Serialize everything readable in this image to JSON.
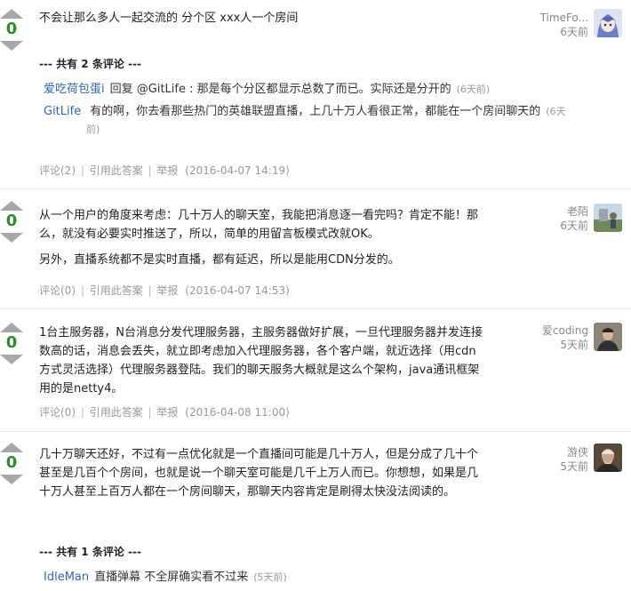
{
  "answers": [
    {
      "votes": "0",
      "body": [
        "不会让那么多人一起交流的 分个区 xxx人一个房间"
      ],
      "author": "TimeFo...",
      "time": "6天前",
      "comments_header": "--- 共有 2 条评论 ---",
      "comments": [
        {
          "user": "爱吃荷包蛋i",
          "text": "回复 @GitLife : 那是每个分区都显示总数了而已。实际还是分开的",
          "date": "(6天前)"
        },
        {
          "user": "GitLife",
          "text": "有的啊，你去看那些热门的英雄联盟直播，上几十万人看很正常，都能在一个房间聊天的",
          "date": "(6天前)"
        }
      ],
      "meta": {
        "comments": "评论(2)",
        "quote": "引用此答案",
        "report": "举报",
        "date": "(2016-04-07 14:19)"
      }
    },
    {
      "votes": "0",
      "body": [
        "从一个用户的角度来考虑：几十万人的聊天室，我能把消息逐一看完吗？肯定不能！那么，就没有必要实时推送了，所以，简单的用留言板模式改就OK。",
        "另外，直播系统都不是实时直播，都有延迟，所以是能用CDN分发的。"
      ],
      "author": "老陌",
      "time": "6天前",
      "meta": {
        "comments": "评论(0)",
        "quote": "引用此答案",
        "report": "举报",
        "date": "(2016-04-07 14:53)"
      }
    },
    {
      "votes": "0",
      "body": [
        "1台主服务器，N台消息分发代理服务器，主服务器做好扩展，一旦代理服务器并发连接数高的话，消息会丢失，就立即考虑加入代理服务器，各个客户端，就近选择（用cdn方式灵活选择）代理服务器登陆。我们的聊天服务大概就是这么个架构，java通讯框架用的是netty4。"
      ],
      "author": "爱coding",
      "time": "5天前",
      "meta": {
        "comments": "评论(0)",
        "quote": "引用此答案",
        "report": "举报",
        "date": "(2016-04-08 11:00)"
      }
    },
    {
      "votes": "0",
      "body": [
        "几十万聊天还好，不过有一点优化就是一个直播间可能是几十万人，但是分成了几十个甚至是几百个个房间，也就是说一个聊天室可能是几千上万人而已。你想想，如果是几十万人甚至上百万人都在一个房间聊天，那聊天内容肯定是刷得太快没法阅读的。"
      ],
      "author": "游侠",
      "time": "5天前",
      "comments_header": "--- 共有 1 条评论 ---",
      "comments": [
        {
          "user": "IdleMan",
          "text": "直播弹幕 不全屏确实看不过来",
          "date": "(5天前)"
        }
      ]
    }
  ],
  "colors": {
    "vote_green": "#2e8b2e",
    "link_blue": "#3366aa",
    "muted": "#999999"
  }
}
